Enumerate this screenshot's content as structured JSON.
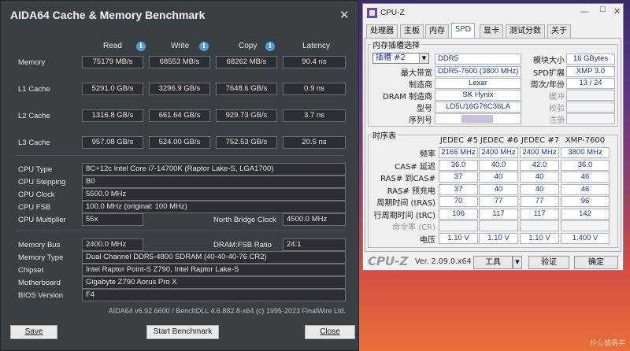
{
  "aida": {
    "title": "AIDA64 Cache & Memory Benchmark",
    "close_glyph": "✕",
    "columns": [
      "Read",
      "Write",
      "Copy",
      "Latency"
    ],
    "rows": [
      {
        "label": "Memory",
        "read": "75179 MB/s",
        "write": "68553 MB/s",
        "copy": "68262 MB/s",
        "latency": "90.4 ns"
      },
      {
        "label": "L1 Cache",
        "read": "5291.0 GB/s",
        "write": "3296.9 GB/s",
        "copy": "7648.6 GB/s",
        "latency": "0.9 ns"
      },
      {
        "label": "L2 Cache",
        "read": "1316.8 GB/s",
        "write": "661.64 GB/s",
        "copy": "929.73 GB/s",
        "latency": "3.7 ns"
      },
      {
        "label": "L3 Cache",
        "read": "957.08 GB/s",
        "write": "524.00 GB/s",
        "copy": "752.53 GB/s",
        "latency": "20.5 ns"
      }
    ],
    "cpu_type_label": "CPU Type",
    "cpu_type": "8C+12c Intel Core i7-14700K  (Raptor Lake-S, LGA1700)",
    "cpu_stepping_label": "CPU Stepping",
    "cpu_stepping": "B0",
    "cpu_clock_label": "CPU Clock",
    "cpu_clock": "5500.0 MHz",
    "cpu_fsb_label": "CPU FSB",
    "cpu_fsb": "100.0 MHz  (original: 100 MHz)",
    "cpu_mult_label": "CPU Multiplier",
    "cpu_mult": "55x",
    "nb_clock_label": "North Bridge Clock",
    "nb_clock": "4500.0 MHz",
    "mem_bus_label": "Memory Bus",
    "mem_bus": "2400.0 MHz",
    "dram_fsb_label": "DRAM:FSB Ratio",
    "dram_fsb": "24:1",
    "mem_type_label": "Memory Type",
    "mem_type": "Dual Channel DDR5-4800 SDRAM  (40-40-40-76 CR2)",
    "chipset_label": "Chipset",
    "chipset": "Intel Raptor Point-S Z790, Intel Raptor Lake-S",
    "mobo_label": "Motherboard",
    "mobo": "Gigabyte Z790 Aorus Pro X",
    "bios_label": "BIOS Version",
    "bios": "F4",
    "footer": "AIDA64 v6.92.6600 / BenchDLL 4.6.882.8-x64  (c) 1995-2023 FinalWire Ltd.",
    "save_label": "Save",
    "start_label": "Start Benchmark",
    "close_label": "Close"
  },
  "cpuz": {
    "title": "CPU-Z",
    "tabs": [
      "处理器",
      "主板",
      "内存",
      "SPD",
      "显卡",
      "测试分数",
      "关于"
    ],
    "active_tab": "SPD",
    "slot_group": "内存插槽选择",
    "slot_value": "插槽 #2",
    "ddr": "DDR5",
    "module_size_label": "模块大小",
    "module_size": "16 GBytes",
    "max_bw_label": "最大带宽",
    "max_bw": "DDR5-7600 (3800 MHz)",
    "spd_ext_label": "SPD扩展",
    "spd_ext": "XMP 3.0",
    "mfr_label": "制造商",
    "mfr": "Lexar",
    "week_year_label": "周次/年份",
    "week_year": "13 / 24",
    "dram_mfr_label": "DRAM 制造商",
    "dram_mfr": "SK Hynix",
    "buffer_label": "缓冲",
    "part_label": "型号",
    "part": "LD5U16G76C36LA",
    "check_label": "校验",
    "serial_label": "序列号",
    "reg_label": "注册",
    "timing_group": "时序表",
    "timing_cols": [
      "JEDEC #5",
      "JEDEC #6",
      "JEDEC #7",
      "XMP-7600"
    ],
    "timing_rows": [
      {
        "label": "频率",
        "vals": [
          "2166 MHz",
          "2400 MHz",
          "2400 MHz",
          "3800 MHz"
        ]
      },
      {
        "label": "CAS# 延迟",
        "vals": [
          "36.0",
          "40.0",
          "42.0",
          "36.0"
        ]
      },
      {
        "label": "RAS# 到CAS#",
        "vals": [
          "37",
          "40",
          "40",
          "46"
        ]
      },
      {
        "label": "RAS# 预充电",
        "vals": [
          "37",
          "40",
          "40",
          "46"
        ]
      },
      {
        "label": "周期时间 (tRAS)",
        "vals": [
          "70",
          "77",
          "77",
          "96"
        ]
      },
      {
        "label": "行周期时间 (tRC)",
        "vals": [
          "106",
          "117",
          "117",
          "142"
        ]
      },
      {
        "label": "命令率 (CR)",
        "vals": [
          "",
          "",
          "",
          ""
        ]
      },
      {
        "label": "电压",
        "vals": [
          "1.10 V",
          "1.10 V",
          "1.10 V",
          "1.400 V"
        ]
      }
    ],
    "logo": "CPU-Z",
    "version": "Ver. 2.09.0.x64",
    "tools_label": "工具",
    "validate_label": "验证",
    "ok_label": "确定"
  },
  "watermark": "什么值得买"
}
